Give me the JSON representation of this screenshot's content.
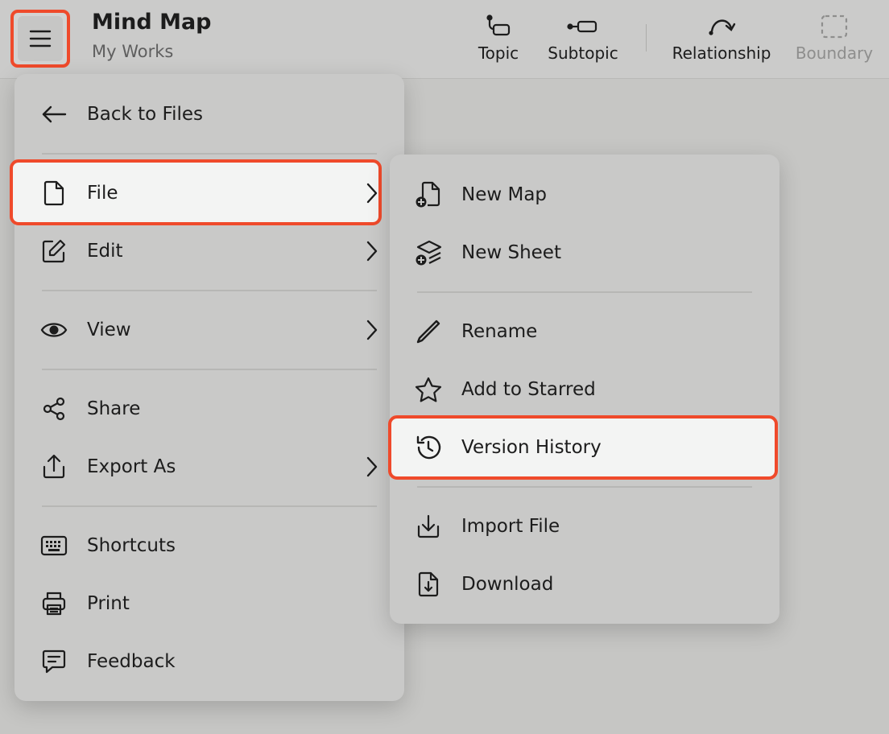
{
  "header": {
    "title": "Mind Map",
    "subtitle": "My Works",
    "menu_icon": "hamburger-icon",
    "tools": [
      {
        "label": "Topic",
        "icon": "topic-icon"
      },
      {
        "label": "Subtopic",
        "icon": "subtopic-icon"
      },
      {
        "label": "Relationship",
        "icon": "relationship-icon"
      },
      {
        "label": "Boundary",
        "icon": "boundary-icon",
        "disabled": true
      }
    ]
  },
  "main_menu": {
    "items": [
      {
        "label": "Back to Files",
        "icon": "arrow-left-icon"
      },
      {
        "label": "File",
        "icon": "file-icon",
        "submenu": true,
        "highlighted": true
      },
      {
        "label": "Edit",
        "icon": "edit-icon",
        "submenu": true
      },
      {
        "label": "View",
        "icon": "eye-icon",
        "submenu": true
      },
      {
        "label": "Share",
        "icon": "share-icon"
      },
      {
        "label": "Export As",
        "icon": "export-icon",
        "submenu": true
      },
      {
        "label": "Shortcuts",
        "icon": "keyboard-icon"
      },
      {
        "label": "Print",
        "icon": "printer-icon"
      },
      {
        "label": "Feedback",
        "icon": "feedback-icon"
      }
    ]
  },
  "file_submenu": {
    "items": [
      {
        "label": "New Map",
        "icon": "new-map-icon"
      },
      {
        "label": "New Sheet",
        "icon": "new-sheet-icon"
      },
      {
        "label": "Rename",
        "icon": "pencil-icon"
      },
      {
        "label": "Add to Starred",
        "icon": "star-icon"
      },
      {
        "label": "Version History",
        "icon": "history-icon",
        "highlighted": true
      },
      {
        "label": "Import File",
        "icon": "import-icon"
      },
      {
        "label": "Download",
        "icon": "download-icon"
      }
    ]
  },
  "colors": {
    "highlight_border": "#ef4a2b",
    "menu_bg": "#c9c9c8",
    "highlight_bg": "#f3f4f3"
  }
}
